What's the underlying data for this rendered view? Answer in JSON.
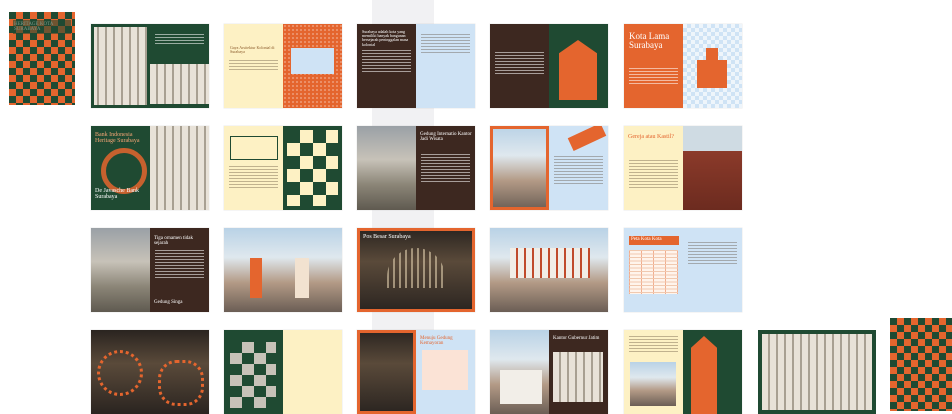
{
  "cover_front": {
    "title": "HERITAGE KOTA SURABAYA"
  },
  "row1": {
    "s2_title": "Gaya Arsitektur Kolonial di Surabaya",
    "s4_text": "Surabaya adalah kota yang memiliki banyak bangunan bersejarah peninggalan masa kolonial",
    "s6_title": "Kota Lama Surabaya"
  },
  "row2": {
    "s1_title": "Bank Indonesia Heritage Surabaya",
    "s1_sub": "De Javasche Bank Surabaya",
    "s3_title": "Gedung Internatio Kantor Jadi Wisata",
    "s6_title": "Gereja atau Kastil?"
  },
  "row3": {
    "s1_title": "Tiga ornamen tidak sejarah",
    "s1_sub": "Gedung Singa",
    "s3_title": "Pos Besar Surabaya",
    "s5_title": "Peta Kota Kota"
  },
  "row4": {
    "s3_title": "Menuju Gedung Kemayoran",
    "s4_title": "Kantor Gubernur Jatim"
  }
}
